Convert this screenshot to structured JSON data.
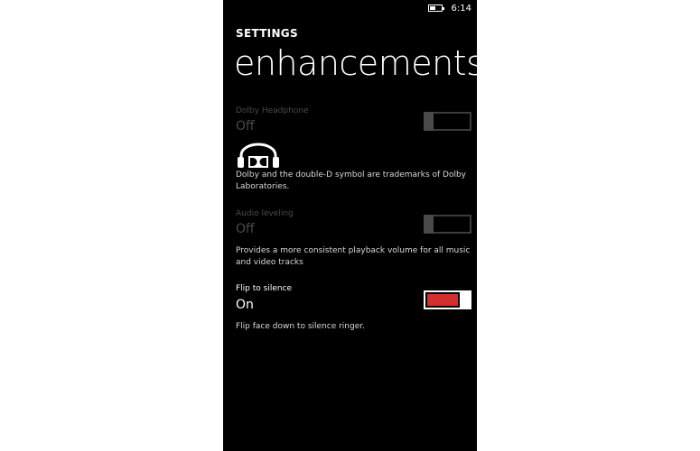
{
  "status_bar": {
    "time": "6:14",
    "battery_icon": "battery-icon"
  },
  "header": {
    "section": "SETTINGS",
    "title": "enhancements"
  },
  "settings": {
    "dolby": {
      "label": "Dolby Headphone",
      "value": "Off",
      "enabled": false,
      "trademark": "Dolby and the double-D symbol are trademarks of Dolby Laboratories.",
      "logo_icon": "dolby-headphone-icon"
    },
    "audio_leveling": {
      "label": "Audio leveling",
      "value": "Off",
      "enabled": false,
      "description": "Provides a more consistent playback volume for all music and video tracks"
    },
    "flip_to_silence": {
      "label": "Flip to silence",
      "value": "On",
      "enabled": true,
      "description": "Flip face down to silence ringer."
    }
  },
  "colors": {
    "accent": "#d32f2f",
    "background": "#000000",
    "disabled": "#4a4a4a"
  }
}
